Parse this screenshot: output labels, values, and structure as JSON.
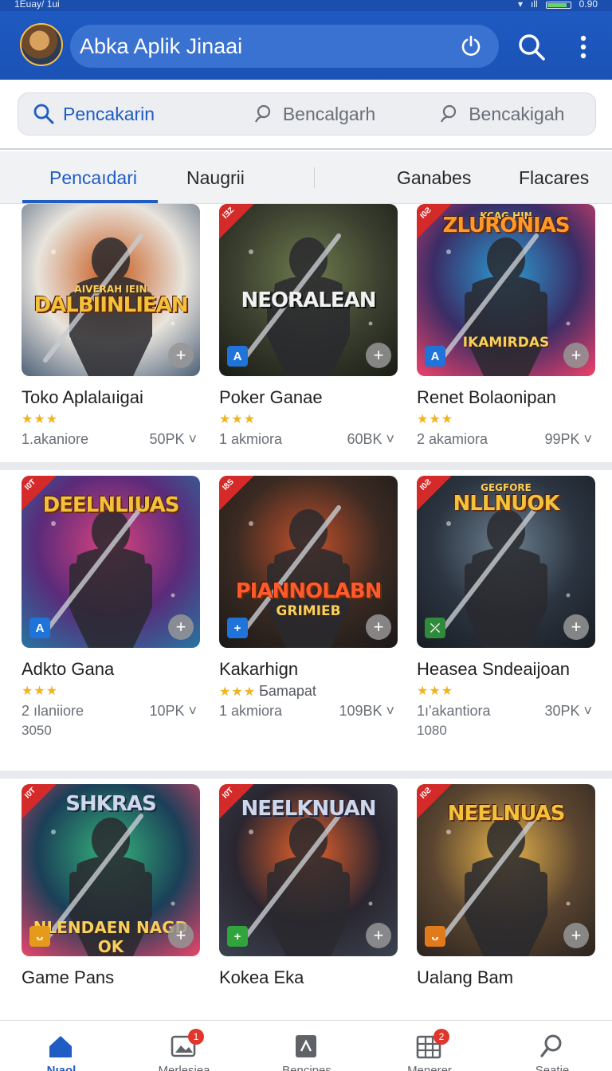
{
  "status_bar": {
    "left": "1Euay/ 1ui",
    "right": "0.90"
  },
  "app_bar": {
    "title": "Abka Aplik Jinaai"
  },
  "search": {
    "segments": [
      {
        "label": "Pencakarin"
      },
      {
        "label": "Bencalgarh"
      },
      {
        "label": "Bencakigah"
      }
    ]
  },
  "tabs": [
    {
      "label": "Pencaıdari"
    },
    {
      "label": "Naugrii"
    },
    {
      "label": "Ganabes"
    },
    {
      "label": "Flacares"
    }
  ],
  "cards": [
    {
      "name": "Toko Aplalaıigai",
      "stars": "★★★",
      "downloads": "1.akaniore",
      "size": "50PK",
      "art_title": "DALBIINLIEAN",
      "art_banner": "AIVERAH IEIN",
      "art_subtitle": "",
      "ribbon": "",
      "badge": "",
      "badge_color": "",
      "colors": [
        "#e8e4dd",
        "#c85a1c",
        "#5a6b80"
      ]
    },
    {
      "name": "Poker Ganae",
      "stars": "★★★",
      "downloads": "1 akmiora",
      "size": "60BK",
      "art_title": "NEORALEAN",
      "art_banner": "",
      "art_subtitle": "",
      "ribbon": "IƎZ",
      "badge": "A",
      "badge_color": "#1f73d9",
      "colors": [
        "#3b3f2f",
        "#6d7a4d",
        "#1c1f17"
      ]
    },
    {
      "name": "Renet Bolaonipan",
      "stars": "★★★",
      "downloads": "2 akamiora",
      "size": "99PK",
      "art_title": "ZLURONIAS",
      "art_banner": "KCAG HIN",
      "art_subtitle": "IKAMIRDAS",
      "ribbon": "I0Ƨ",
      "badge": "A",
      "badge_color": "#1f73d9",
      "colors": [
        "#3a2d66",
        "#2b9ad0",
        "#e0406a"
      ]
    },
    {
      "name": "Adkto Gana",
      "stars": "★★★",
      "downloads": "2 ılaniiore",
      "size": "10PK",
      "extra": "3050",
      "art_title": "DEELNLIUAS",
      "art_banner": "",
      "art_subtitle": "",
      "ribbon": "I0Ƭ",
      "badge": "A",
      "badge_color": "#1f73d9",
      "colors": [
        "#5b2b7a",
        "#d9427e",
        "#2a6f9e"
      ]
    },
    {
      "name": "Kakarhign",
      "stars": "★★★",
      "stars_extra": "Ƃamapat",
      "downloads": "1 akmiora",
      "size": "109BK",
      "art_title": "PIANNOLABN",
      "art_banner": "",
      "art_subtitle": "GRIMIEB",
      "ribbon": "I8S",
      "badge": "+",
      "badge_color": "#1f73d9",
      "colors": [
        "#3a2a22",
        "#c3502b",
        "#1d1a18"
      ]
    },
    {
      "name": "Heasea Sndeaijoan",
      "stars": "★★★",
      "downloads": "1ı'akantiora",
      "size": "30PK",
      "extra": "1080",
      "art_title": "NLLNUOK",
      "art_banner": "GEGFORE",
      "art_subtitle": "",
      "ribbon": "I0Ƨ",
      "badge": "⤫",
      "badge_color": "#2f8a3a",
      "colors": [
        "#2b3440",
        "#6b7f8f",
        "#1a1f26"
      ]
    },
    {
      "name": "Game Pans",
      "stars": "",
      "downloads": "",
      "size": "",
      "art_title": "SHKRAS",
      "art_banner": "",
      "art_subtitle": "NLENDAEN NAGD OK",
      "ribbon": "I0Ƭ",
      "badge": "ᴗ",
      "badge_color": "#e69a1c",
      "colors": [
        "#1b3f58",
        "#34b27a",
        "#d9456b"
      ]
    },
    {
      "name": "Kokea Eka",
      "stars": "",
      "downloads": "",
      "size": "",
      "art_title": "NEELKNUAN",
      "art_banner": "",
      "art_subtitle": "",
      "ribbon": "I0Ƭ",
      "badge": "+",
      "badge_color": "#2fa53c",
      "colors": [
        "#2a2630",
        "#e8612b",
        "#39404d"
      ]
    },
    {
      "name": "Ualang Bam",
      "stars": "",
      "downloads": "",
      "size": "",
      "art_title": "NEELNUAS",
      "art_banner": "",
      "art_subtitle": "",
      "ribbon": "I0Ƨ",
      "badge": "ᴗ",
      "badge_color": "#e07a1c",
      "colors": [
        "#5a4530",
        "#e6b24a",
        "#2e2620"
      ]
    }
  ],
  "bottom_nav": [
    {
      "label": "Nıaol",
      "icon": "home-icon",
      "badge": ""
    },
    {
      "label": "Merlesiea",
      "icon": "image-icon",
      "badge": "1"
    },
    {
      "label": "Bencipes",
      "icon": "book-icon",
      "badge": ""
    },
    {
      "label": "Menerer",
      "icon": "grid-icon",
      "badge": "2"
    },
    {
      "label": "Seatie",
      "icon": "search-icon",
      "badge": ""
    }
  ],
  "theme": {
    "primary": "#1f5cc4",
    "appbar": "#1b52b5",
    "star": "#f0b323",
    "badge": "#e0362c"
  }
}
